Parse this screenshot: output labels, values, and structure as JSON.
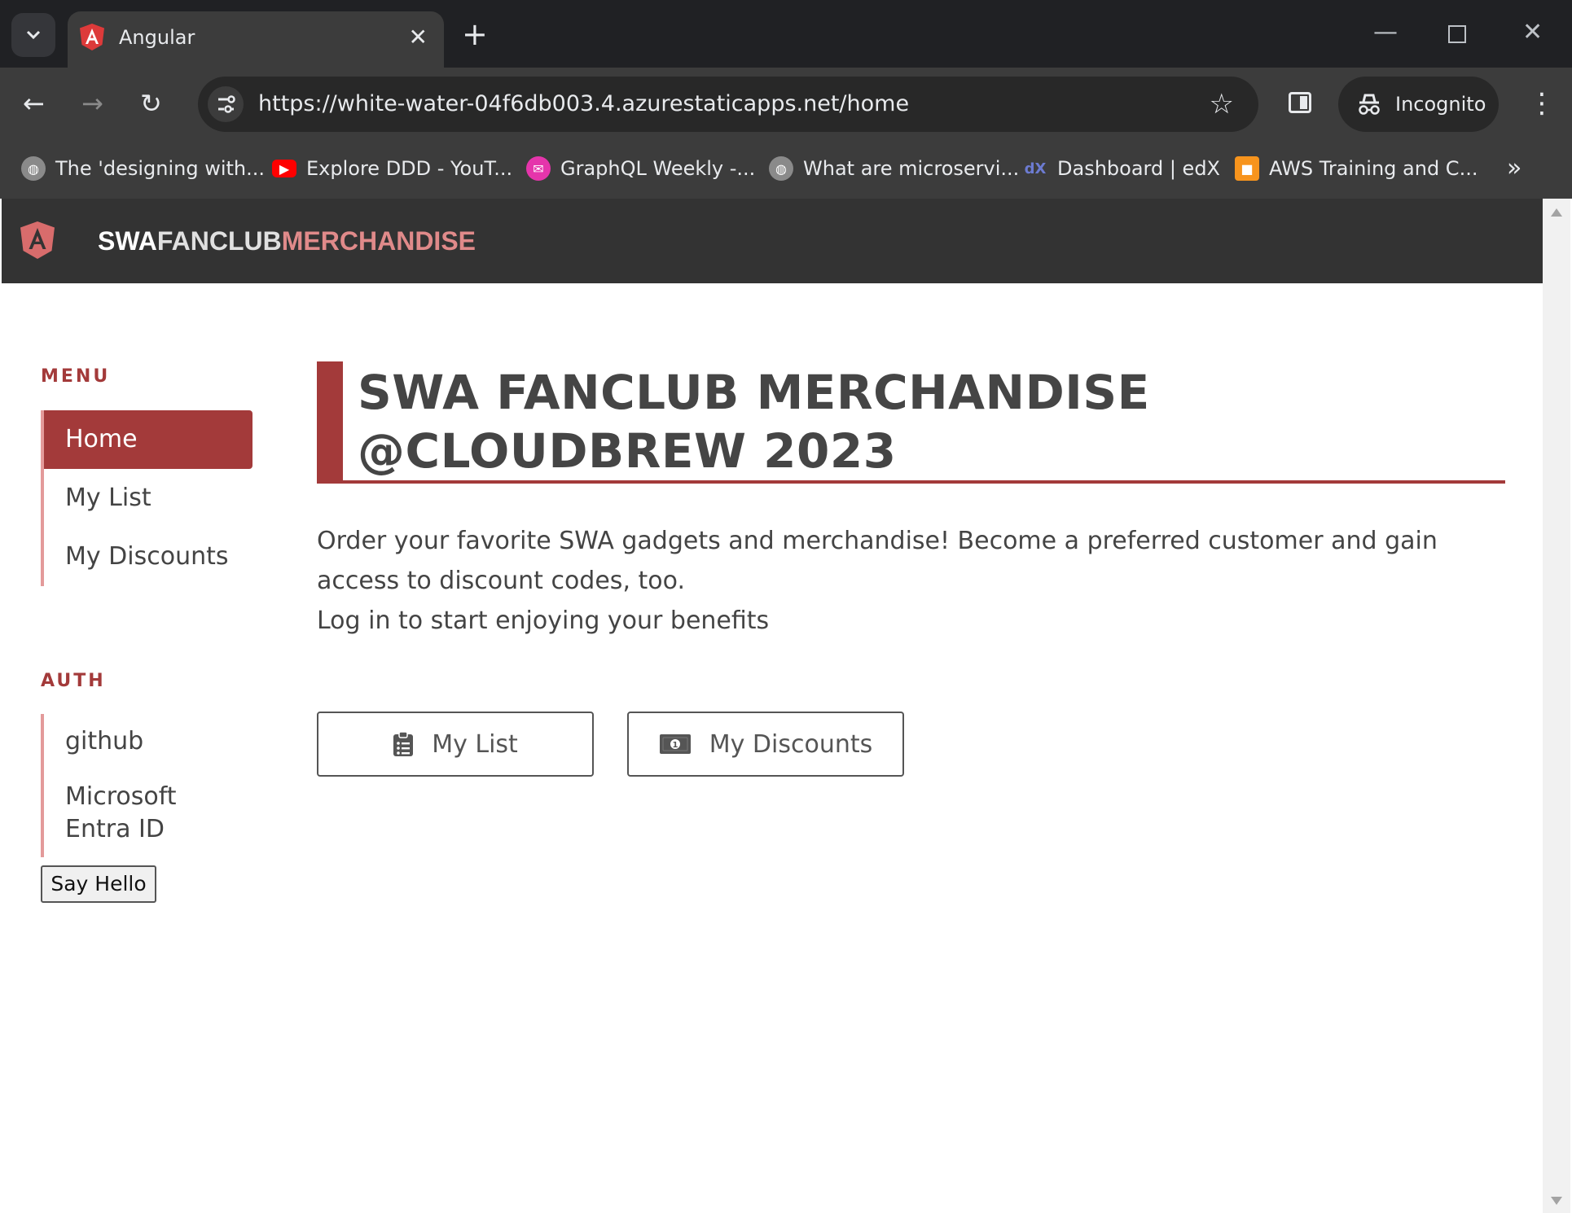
{
  "browser": {
    "tab_title": "Angular",
    "url": "https://white-water-04f6db003.4.azurestaticapps.net/home",
    "incognito_label": "Incognito",
    "bookmarks": [
      {
        "label": "The 'designing with...",
        "icon": "globe-icon",
        "color": "#5f6368"
      },
      {
        "label": "Explore DDD - YouT...",
        "icon": "youtube-icon",
        "color": "#ff0000"
      },
      {
        "label": "GraphQL Weekly -...",
        "icon": "graphql-mail-icon",
        "color": "#e535ab"
      },
      {
        "label": "What are microservi...",
        "icon": "globe-icon",
        "color": "#5f6368"
      },
      {
        "label": "Dashboard | edX",
        "icon": "edx-icon",
        "color": "#02262b"
      },
      {
        "label": "AWS Training and C...",
        "icon": "aws-cube-icon",
        "color": "#f7941d"
      }
    ]
  },
  "app": {
    "brand": {
      "part1": "SWA",
      "part2": "FANCLUB",
      "part3": "MERCHANDISE"
    },
    "colors": {
      "accent": "#a33a3a",
      "header_bg": "#333333",
      "brand_pink": "#e08a8a"
    }
  },
  "sidebar": {
    "menu_label": "MENU",
    "menu_items": [
      {
        "label": "Home",
        "active": true
      },
      {
        "label": "My List",
        "active": false
      },
      {
        "label": "My Discounts",
        "active": false
      }
    ],
    "auth_label": "AUTH",
    "auth_items": [
      {
        "label": "github"
      },
      {
        "label": "Microsoft Entra ID"
      }
    ],
    "say_hello_label": "Say Hello"
  },
  "main": {
    "title": "SWA FANCLUB MERCHANDISE @CLOUDBREW 2023",
    "intro_line1": "Order your favorite SWA gadgets and merchandise! Become a preferred customer and gain access to discount codes, too.",
    "intro_line2": "Log in to start enjoying your benefits",
    "buttons": [
      {
        "label": "My List",
        "icon": "clipboard-icon"
      },
      {
        "label": "My Discounts",
        "icon": "money-bill-icon"
      }
    ]
  }
}
